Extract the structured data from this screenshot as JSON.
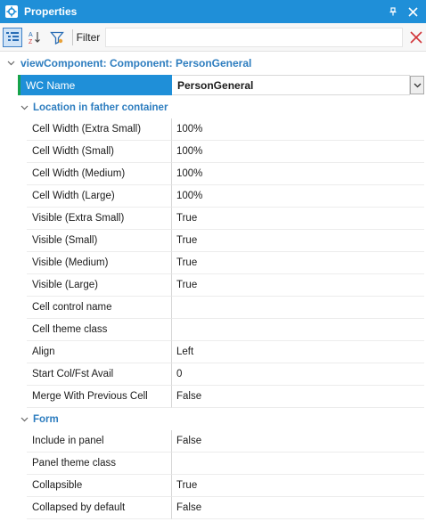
{
  "window": {
    "title": "Properties",
    "pin_icon": "pin-icon",
    "close_icon": "close-icon",
    "accent": "#1f8fd8"
  },
  "toolbar": {
    "filter_label": "Filter",
    "filter_value": "",
    "buttons": [
      "categorized-view-icon",
      "sort-alphabetical-icon",
      "filter-funnel-icon",
      "clear-filter-icon"
    ]
  },
  "object": {
    "header": "viewComponent: Component: PersonGeneral",
    "wc_name_label": "WC Name",
    "wc_name_value": "PersonGeneral"
  },
  "categories": [
    {
      "title": "Location in father container",
      "properties": [
        {
          "name": "Cell Width (Extra Small)",
          "value": "100%"
        },
        {
          "name": "Cell Width (Small)",
          "value": "100%"
        },
        {
          "name": "Cell Width (Medium)",
          "value": "100%"
        },
        {
          "name": "Cell Width (Large)",
          "value": "100%"
        },
        {
          "name": "Visible (Extra Small)",
          "value": "True"
        },
        {
          "name": "Visible (Small)",
          "value": "True"
        },
        {
          "name": "Visible (Medium)",
          "value": "True"
        },
        {
          "name": "Visible (Large)",
          "value": "True"
        },
        {
          "name": "Cell control name",
          "value": ""
        },
        {
          "name": "Cell theme class",
          "value": ""
        },
        {
          "name": "Align",
          "value": "Left"
        },
        {
          "name": "Start Col/Fst Avail",
          "value": "0"
        },
        {
          "name": "Merge With Previous Cell",
          "value": "False"
        }
      ]
    },
    {
      "title": "Form",
      "properties": [
        {
          "name": "Include in panel",
          "value": "False"
        },
        {
          "name": "Panel theme class",
          "value": ""
        },
        {
          "name": "Collapsible",
          "value": "True"
        },
        {
          "name": "Collapsed by default",
          "value": "False"
        }
      ]
    }
  ]
}
